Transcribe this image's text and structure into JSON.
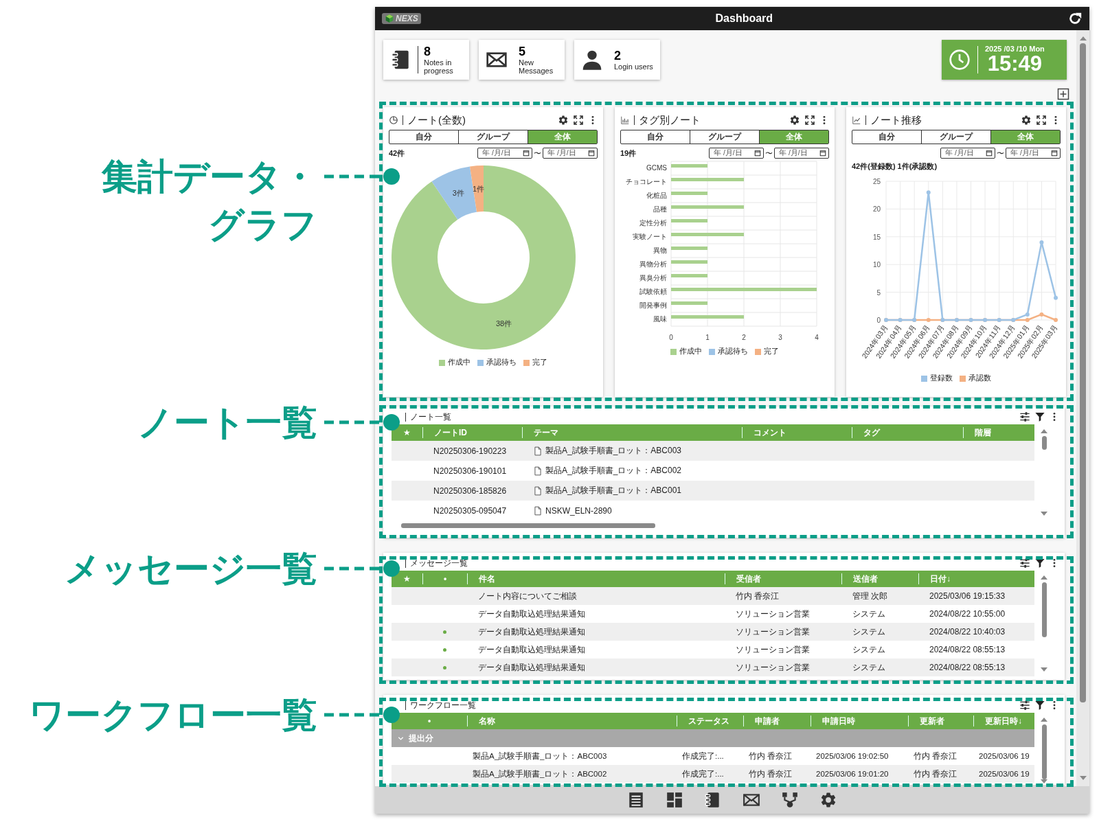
{
  "annotations": [
    {
      "lines": [
        "集計データ・",
        "グラフ"
      ]
    },
    {
      "lines": [
        "ノート一覧"
      ]
    },
    {
      "lines": [
        "メッセージ一覧"
      ]
    },
    {
      "lines": [
        "ワークフロー一覧"
      ]
    }
  ],
  "window": {
    "logo": "NEXS",
    "title": "Dashboard"
  },
  "stats": [
    {
      "kind": "notes",
      "count": "8",
      "label": "Notes in progress"
    },
    {
      "kind": "messages",
      "count": "5",
      "label": "New Messages"
    },
    {
      "kind": "users",
      "count": "2",
      "label": "Login users"
    }
  ],
  "clock": {
    "date": "2025 /03 /10 Mon",
    "time": "15:49"
  },
  "widgets": [
    {
      "kind": "donut",
      "title": "ノート(全数)",
      "tabs": [
        {
          "label": "自分",
          "selected": false
        },
        {
          "label": "グループ",
          "selected": false
        },
        {
          "label": "全体",
          "selected": true
        }
      ],
      "count": "42件",
      "date_from": {
        "placeholder": "年 /月/日"
      },
      "range_separator": "〜",
      "date_to": {
        "placeholder": "年 /月/日"
      },
      "chart_data": {
        "type": "donut",
        "categories": [
          "作成中",
          "承認待ち",
          "完了"
        ],
        "values": [
          38,
          3,
          1
        ],
        "colors": [
          "#a9d18e",
          "#9dc3e6",
          "#f4b183"
        ],
        "value_labels": [
          "38件",
          "3件",
          "1件"
        ]
      }
    },
    {
      "kind": "bar",
      "title": "タグ別ノート",
      "tabs": [
        {
          "label": "自分",
          "selected": false
        },
        {
          "label": "グループ",
          "selected": false
        },
        {
          "label": "全体",
          "selected": true
        }
      ],
      "count": "19件",
      "date_from": {
        "placeholder": "年 /月/日"
      },
      "range_separator": "〜",
      "date_to": {
        "placeholder": "年 /月/日"
      },
      "chart_data": {
        "type": "bar",
        "orientation": "horizontal",
        "stacked": true,
        "categories": [
          "GCMS",
          "チョコレート",
          "化粧品",
          "品種",
          "定性分析",
          "実験ノート",
          "異物",
          "異物分析",
          "異臭分析",
          "試験依頼",
          "開発事例",
          "風味"
        ],
        "series": [
          {
            "name": "作成中",
            "color": "#a9d18e",
            "values": [
              1,
              2,
              1,
              2,
              1,
              2,
              1,
              1,
              1,
              4,
              1,
              2
            ]
          },
          {
            "name": "承認待ち",
            "color": "#9dc3e6",
            "values": [
              0,
              0,
              0,
              0,
              0,
              0,
              0,
              0,
              0,
              0,
              0,
              0
            ]
          },
          {
            "name": "完了",
            "color": "#f4b183",
            "values": [
              0,
              0,
              0,
              0,
              0,
              0,
              0,
              0,
              0,
              0,
              0,
              0
            ]
          }
        ],
        "xlim": [
          0,
          4
        ],
        "xticks": [
          0,
          1,
          2,
          3,
          4
        ],
        "grid": true
      }
    },
    {
      "kind": "line",
      "title": "ノート推移",
      "tabs": [
        {
          "label": "自分",
          "selected": false
        },
        {
          "label": "グループ",
          "selected": false
        },
        {
          "label": "全体",
          "selected": true
        }
      ],
      "summary": "42件(登録数) 1件(承認数)",
      "date_from": {
        "placeholder": "年 /月/日"
      },
      "range_separator": "〜",
      "date_to": {
        "placeholder": "年 /月/日"
      },
      "chart_data": {
        "type": "line",
        "x": [
          "2024年03月",
          "2024年04月",
          "2024年05月",
          "2024年06月",
          "2024年07月",
          "2024年08月",
          "2024年09月",
          "2024年10月",
          "2024年11月",
          "2024年12月",
          "2025年01月",
          "2025年02月",
          "2025年03月"
        ],
        "series": [
          {
            "name": "登録数",
            "color": "#9dc3e6",
            "values": [
              0,
              0,
              0,
              23,
              0,
              0,
              0,
              0,
              0,
              0,
              1,
              14,
              4
            ],
            "marker": true
          },
          {
            "name": "承認数",
            "color": "#f4b183",
            "values": [
              0,
              0,
              0,
              0,
              0,
              0,
              0,
              0,
              0,
              0,
              0,
              1,
              0
            ],
            "marker": true
          }
        ],
        "ylim": [
          0,
          25
        ],
        "yticks": [
          0,
          5,
          10,
          15,
          20,
          25
        ],
        "grid": true
      }
    }
  ],
  "lists": [
    {
      "kind": "notes",
      "title": "ノート一覧",
      "columns": [
        "★",
        "ノートID",
        "テーマ",
        "コメント",
        "タグ",
        "階層"
      ],
      "rows": [
        {
          "note_id": "N20250306-190223",
          "theme": "製品A_試験手順書_ロット：ABC003"
        },
        {
          "note_id": "N20250306-190101",
          "theme": "製品A_試験手順書_ロット：ABC002"
        },
        {
          "note_id": "N20250306-185826",
          "theme": "製品A_試験手順書_ロット：ABC001"
        },
        {
          "note_id": "N20250305-095047",
          "theme": "NSKW_ELN-2890"
        }
      ]
    },
    {
      "kind": "messages",
      "title": "メッセージ一覧",
      "columns": [
        "★",
        "•",
        "件名",
        "受信者",
        "送信者",
        "日付↓"
      ],
      "rows": [
        {
          "unread": false,
          "subject": "ノート内容についてご相談",
          "recipient": "竹内 香奈江",
          "sender": "管理 次郎",
          "date": "2025/03/06 19:15:33"
        },
        {
          "unread": false,
          "subject": "データ自動取込処理結果通知",
          "recipient": "ソリューション営業",
          "sender": "システム",
          "date": "2024/08/22 10:55:00"
        },
        {
          "unread": true,
          "subject": "データ自動取込処理結果通知",
          "recipient": "ソリューション営業",
          "sender": "システム",
          "date": "2024/08/22 10:40:03"
        },
        {
          "unread": true,
          "subject": "データ自動取込処理結果通知",
          "recipient": "ソリューション営業",
          "sender": "システム",
          "date": "2024/08/22 08:55:13"
        },
        {
          "unread": true,
          "subject": "データ自動取込処理結果通知",
          "recipient": "ソリューション営業",
          "sender": "システム",
          "date": "2024/08/22 08:55:13"
        }
      ]
    },
    {
      "kind": "workflow",
      "title": "ワークフロー一覧",
      "columns": [
        "•",
        "名称",
        "ステータス",
        "申請者",
        "申請日時",
        "更新者",
        "更新日時↓"
      ],
      "groups": [
        {
          "label": "提出分",
          "expanded": true,
          "rows": [
            {
              "name": "製品A_試験手順書_ロット：ABC003",
              "status": "作成完了:...",
              "applicant": "竹内 香奈江",
              "applied_at": "2025/03/06 19:02:50",
              "updater": "竹内 香奈江",
              "updated_at": "2025/03/06 19"
            },
            {
              "name": "製品A_試験手順書_ロット：ABC002",
              "status": "作成完了:...",
              "applicant": "竹内 香奈江",
              "applied_at": "2025/03/06 19:01:20",
              "updater": "竹内 香奈江",
              "updated_at": "2025/03/06 19"
            }
          ]
        }
      ]
    }
  ]
}
